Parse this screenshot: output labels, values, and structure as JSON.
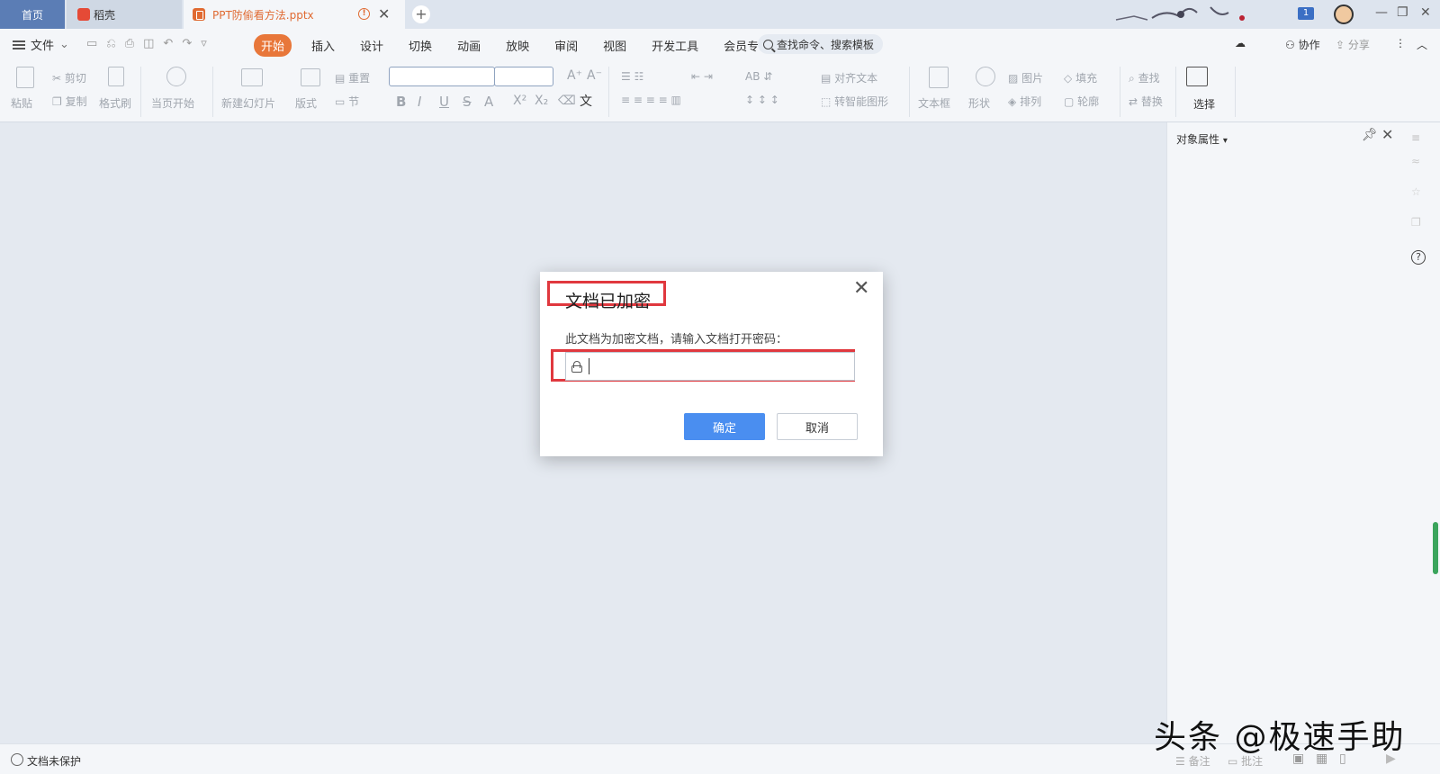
{
  "tabs": {
    "home": "首页",
    "daoke": "稻壳",
    "document": "PPT防偷看方法.pptx"
  },
  "titlebar": {
    "notification_count": "1"
  },
  "menubar": {
    "file": "文件",
    "items": [
      "开始",
      "插入",
      "设计",
      "切换",
      "动画",
      "放映",
      "审阅",
      "视图",
      "开发工具",
      "会员专享"
    ],
    "active_item": "开始",
    "search": "查找命令、搜索模板",
    "collaborate": "协作",
    "share": "分享"
  },
  "ribbon": {
    "paste": "粘贴",
    "cut": "剪切",
    "copy": "复制",
    "format_painter": "格式刷",
    "from_current": "当页开始",
    "new_slide": "新建幻灯片",
    "layout": "版式",
    "reset": "重置",
    "section": "节",
    "align_text": "对齐文本",
    "smart_shape": "转智能图形",
    "text_box": "文本框",
    "shape": "形状",
    "picture": "图片",
    "fill": "填充",
    "arrange": "排列",
    "outline": "轮廓",
    "find": "查找",
    "replace": "替换",
    "select": "选择",
    "bold": "B",
    "italic": "I",
    "underline": "U",
    "strike": "S"
  },
  "side_panel": {
    "title": "对象属性"
  },
  "dialog": {
    "title": "文档已加密",
    "message": "此文档为加密文档，请输入文档打开密码：",
    "password_value": "",
    "ok_label": "确定",
    "cancel_label": "取消"
  },
  "statusbar": {
    "protection": "文档未保护",
    "notes": "备注",
    "comments": "批注"
  },
  "watermark": "头条 @极速手助"
}
